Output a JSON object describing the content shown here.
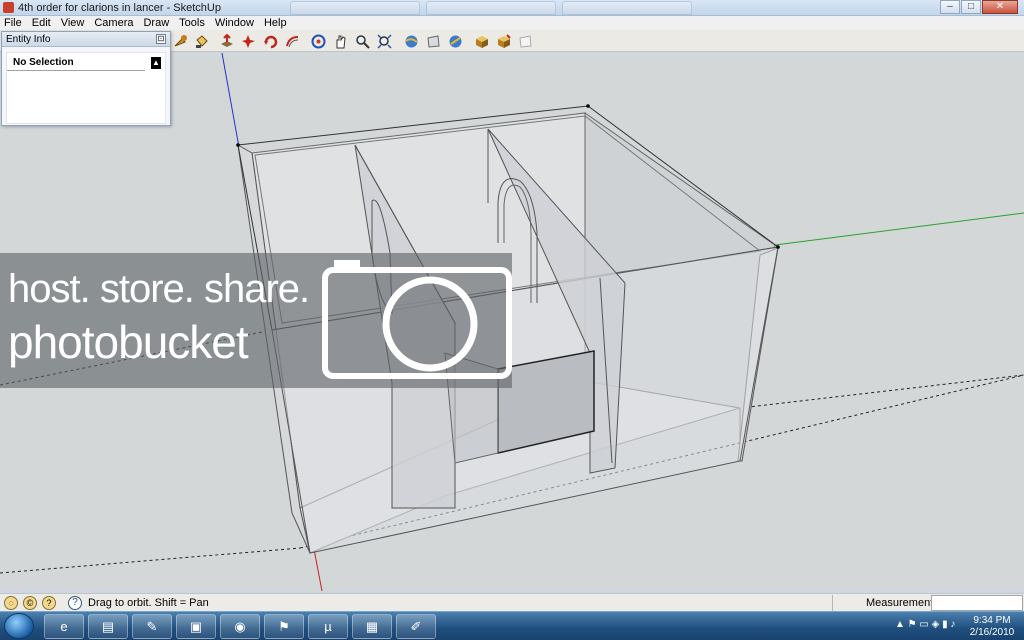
{
  "window": {
    "title": "4th order for clarions in lancer - SketchUp",
    "minimize": "–",
    "maximize": "□",
    "close": "✕"
  },
  "menu": [
    "File",
    "Edit",
    "View",
    "Camera",
    "Draw",
    "Tools",
    "Window",
    "Help"
  ],
  "toolbar": {
    "icons": [
      "move-tool-icon",
      "paint-bucket-icon",
      "push-pull-icon",
      "rotate-icon",
      "follow-me-icon",
      "offset-icon",
      "orbit-icon",
      "pan-icon",
      "zoom-icon",
      "zoom-extents-icon",
      "section-plane-icon",
      "walk-icon",
      "look-around-icon",
      "get-models-icon",
      "share-model-icon",
      "send-to-layout-icon"
    ]
  },
  "entity_info": {
    "title": "Entity Info",
    "close_glyph": "⊡",
    "selection": "No Selection"
  },
  "watermark": {
    "line1": "host. store. share.",
    "line2": "photobucket"
  },
  "status": {
    "message": "Drag to orbit.  Shift = Pan",
    "measurements_label": "Measurements",
    "measurements_value": "",
    "indicators": [
      "geo-location-icon",
      "credits-icon",
      "instructor-icon"
    ]
  },
  "taskbar": {
    "apps": [
      "internet-explorer-icon",
      "file-explorer-icon",
      "sketchup-icon",
      "monitor-app-icon",
      "chrome-icon",
      "runner-app-icon",
      "utorrent-icon",
      "calculator-icon",
      "notes-icon"
    ],
    "time": "9:34 PM",
    "date": "2/16/2010"
  },
  "colors": {
    "x_axis": "#2aa02a",
    "y_axis": "#2233cc",
    "z_axis": "#cc2020",
    "viewport_bg": "#d3d7d8"
  }
}
